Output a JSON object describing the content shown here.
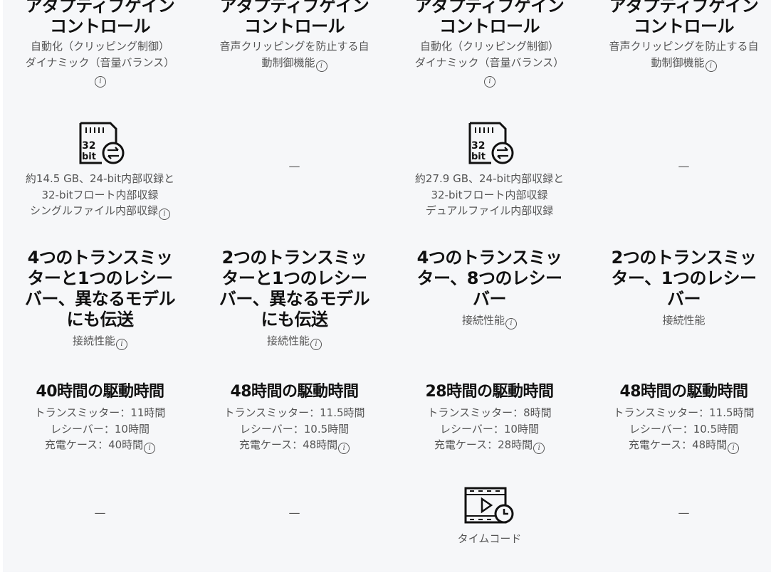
{
  "columns": [
    {
      "agc_title": "アダプティブゲインコントロール",
      "agc_desc": [
        "自動化（クリッピング制御）",
        "ダイナミック（音量バランス）"
      ],
      "agc_info": true,
      "rec_icon": "32bit-chip-icon",
      "rec_desc": [
        "約14.5 GB、24-bit内部収録と",
        "32-bitフロート内部収録",
        "シングルファイル内部収録"
      ],
      "rec_info": true,
      "conn_title": "4つのトランスミッターと1つのレシーバー、異なるモデルにも伝送",
      "conn_desc": "接続性能",
      "conn_info": true,
      "batt_title": "40時間の駆動時間",
      "batt_desc": [
        "トランスミッター：11時間",
        "レシーバー：10時間",
        "充電ケース：40時間"
      ],
      "tc_dash": "—"
    },
    {
      "agc_title": "アダプティブゲインコントロール",
      "agc_desc": [
        "音声クリッピングを防止する自",
        "動制御機能"
      ],
      "agc_info": true,
      "rec_dash": "—",
      "conn_title": "2つのトランスミッターと1つのレシーバー、異なるモデルにも伝送",
      "conn_desc": "接続性能",
      "conn_info": true,
      "batt_title": "48時間の駆動時間",
      "batt_desc": [
        "トランスミッター：11.5時間",
        "レシーバー：10.5時間",
        "充電ケース：48時間"
      ],
      "tc_dash": "—"
    },
    {
      "agc_title": "アダプティブゲインコントロール",
      "agc_desc": [
        "自動化（クリッピング制御）",
        "ダイナミック（音量バランス）"
      ],
      "agc_info": true,
      "rec_icon": "32bit-chip-icon",
      "rec_desc": [
        "約27.9 GB、24-bit内部収録と",
        "32-bitフロート内部収録",
        "デュアルファイル内部収録"
      ],
      "conn_title": "4つのトランスミッター、8つのレシーバー",
      "conn_desc": "接続性能",
      "conn_info": true,
      "batt_title": "28時間の駆動時間",
      "batt_desc": [
        "トランスミッター：8時間",
        "レシーバー：10時間",
        "充電ケース：28時間"
      ],
      "tc_icon": "timecode-icon",
      "tc_label": "タイムコード"
    },
    {
      "agc_title": "アダプティブゲインコントロール",
      "agc_desc": [
        "音声クリッピングを防止する自",
        "動制御機能"
      ],
      "agc_info": true,
      "rec_dash": "—",
      "conn_title": "2つのトランスミッター、1つのレシーバー",
      "conn_desc": "接続性能",
      "batt_title": "48時間の駆動時間",
      "batt_desc": [
        "トランスミッター：11.5時間",
        "レシーバー：10.5時間",
        "充電ケース：48時間"
      ],
      "tc_dash": "—"
    }
  ],
  "chip_icon_text": [
    "32",
    "bit"
  ],
  "info_glyph": "i"
}
